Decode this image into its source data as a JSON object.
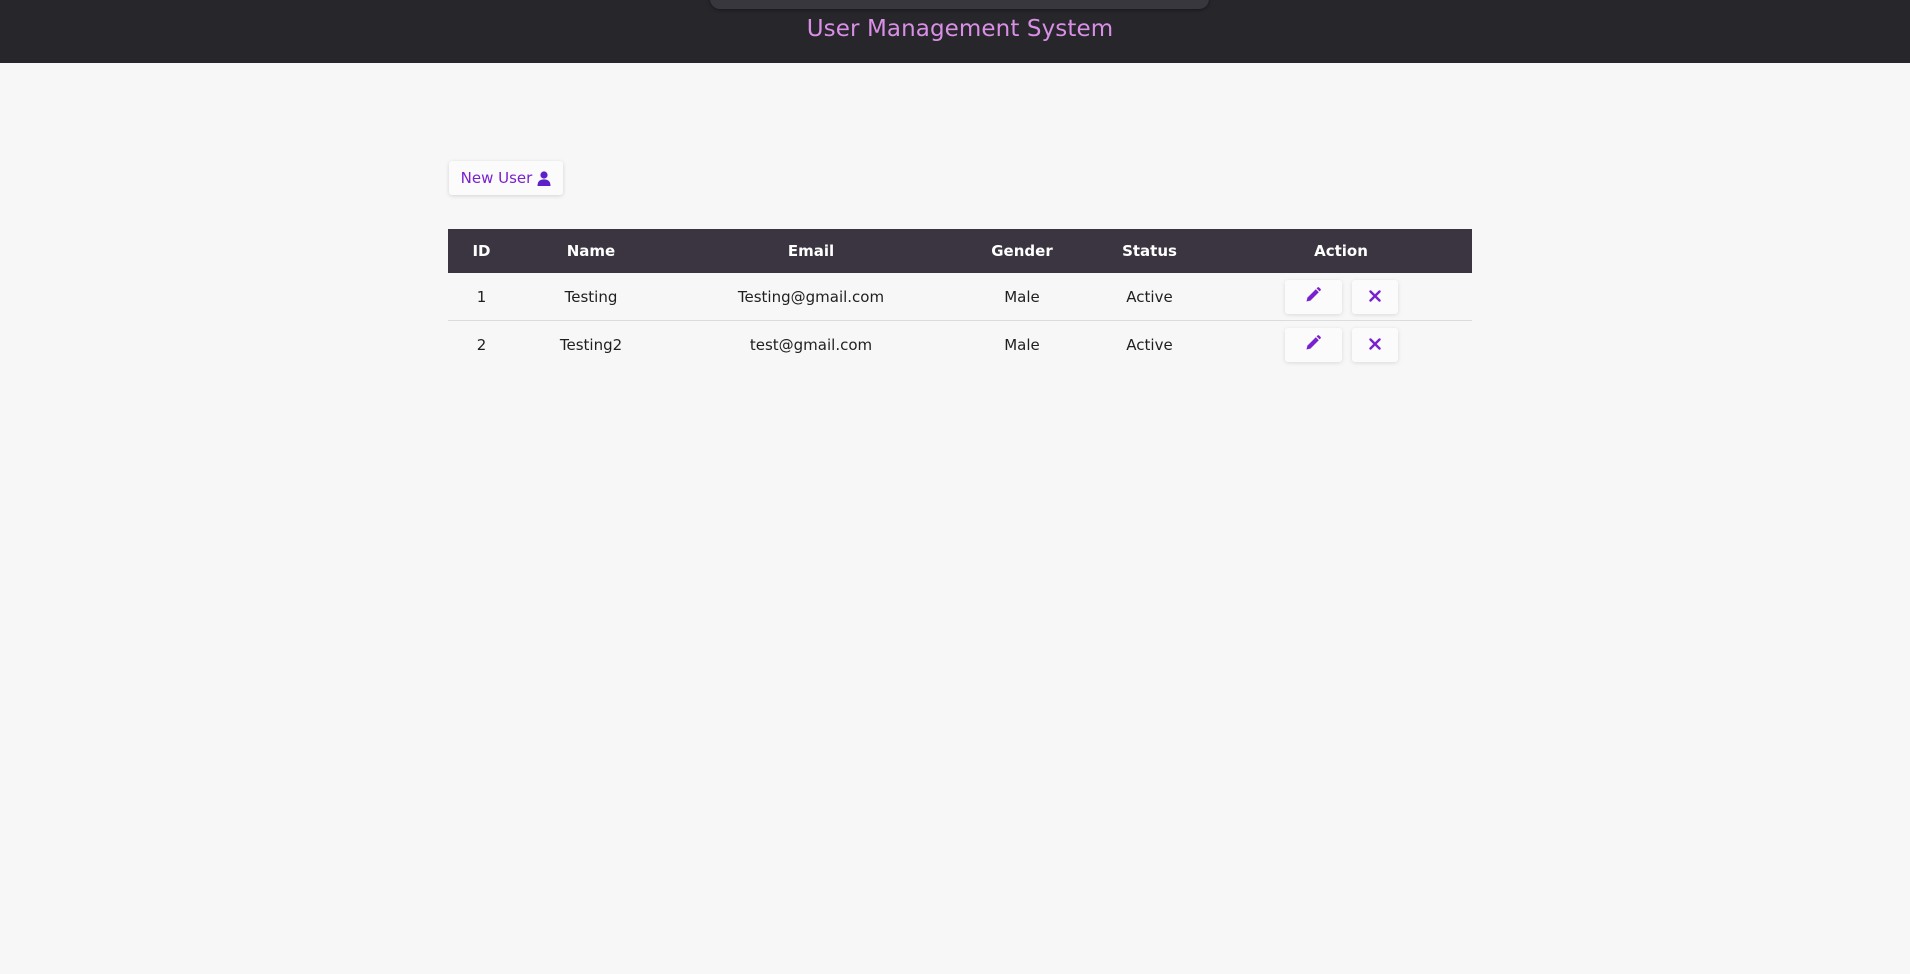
{
  "header": {
    "title": "User Management System"
  },
  "toolbar": {
    "new_user_label": "New User",
    "new_user_icon": "user-icon"
  },
  "colors": {
    "header_bg": "#27262b",
    "title": "#d98fe6",
    "accent": "#7a21cf",
    "table_header_bg": "#3a3540",
    "page_bg": "#f7f7f7"
  },
  "table": {
    "columns": [
      "ID",
      "Name",
      "Email",
      "Gender",
      "Status",
      "Action"
    ],
    "rows": [
      {
        "id": "1",
        "name": "Testing",
        "email": "Testing@gmail.com",
        "gender": "Male",
        "status": "Active"
      },
      {
        "id": "2",
        "name": "Testing2",
        "email": "test@gmail.com",
        "gender": "Male",
        "status": "Active"
      }
    ],
    "row_actions": [
      "pencil-icon",
      "close-icon"
    ]
  }
}
